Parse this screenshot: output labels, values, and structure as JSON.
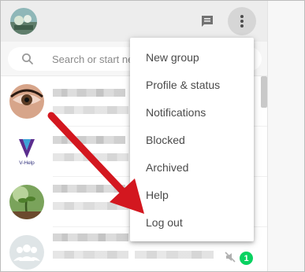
{
  "header": {
    "profile_avatar": "profile-avatar",
    "new_chat_icon": "chat-icon",
    "menu_icon": "more-vertical-icon"
  },
  "search": {
    "placeholder": "Search or start new chat",
    "icon": "search-icon"
  },
  "menu": {
    "items": [
      {
        "label": "New group"
      },
      {
        "label": "Profile & status"
      },
      {
        "label": "Notifications"
      },
      {
        "label": "Blocked"
      },
      {
        "label": "Archived"
      },
      {
        "label": "Help"
      },
      {
        "label": "Log out"
      }
    ]
  },
  "chats": {
    "last_row_unread": "1",
    "mute_icon": "muted-icon",
    "blurred_avatar_text": "V-Help"
  },
  "annotation": {
    "arrow_color": "#d3171f",
    "points_to": "Log out"
  },
  "colors": {
    "header_bg": "#ededed",
    "unread_badge": "#09d261",
    "arrow": "#d3171f"
  }
}
